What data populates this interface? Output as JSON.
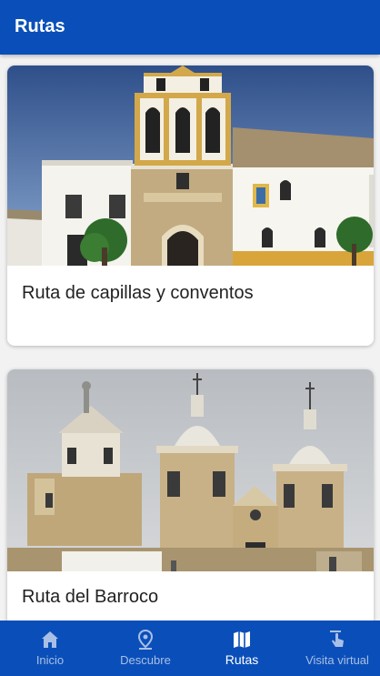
{
  "appbar": {
    "title": "Rutas"
  },
  "routes": [
    {
      "title": "Ruta de capillas y conventos",
      "image": "church-with-bell-tower-photo"
    },
    {
      "title": "Ruta del Barroco",
      "image": "baroque-church-towers-photo"
    }
  ],
  "nav": {
    "items": [
      {
        "label": "Inicio",
        "icon": "home-icon",
        "active": false
      },
      {
        "label": "Descubre",
        "icon": "location-pin-icon",
        "active": false
      },
      {
        "label": "Rutas",
        "icon": "map-icon",
        "active": true
      },
      {
        "label": "Visita virtual",
        "icon": "touch-icon",
        "active": false
      }
    ]
  },
  "colors": {
    "primary": "#0a4fb9",
    "inactive": "#a9bfe6",
    "active": "#ffffff"
  }
}
